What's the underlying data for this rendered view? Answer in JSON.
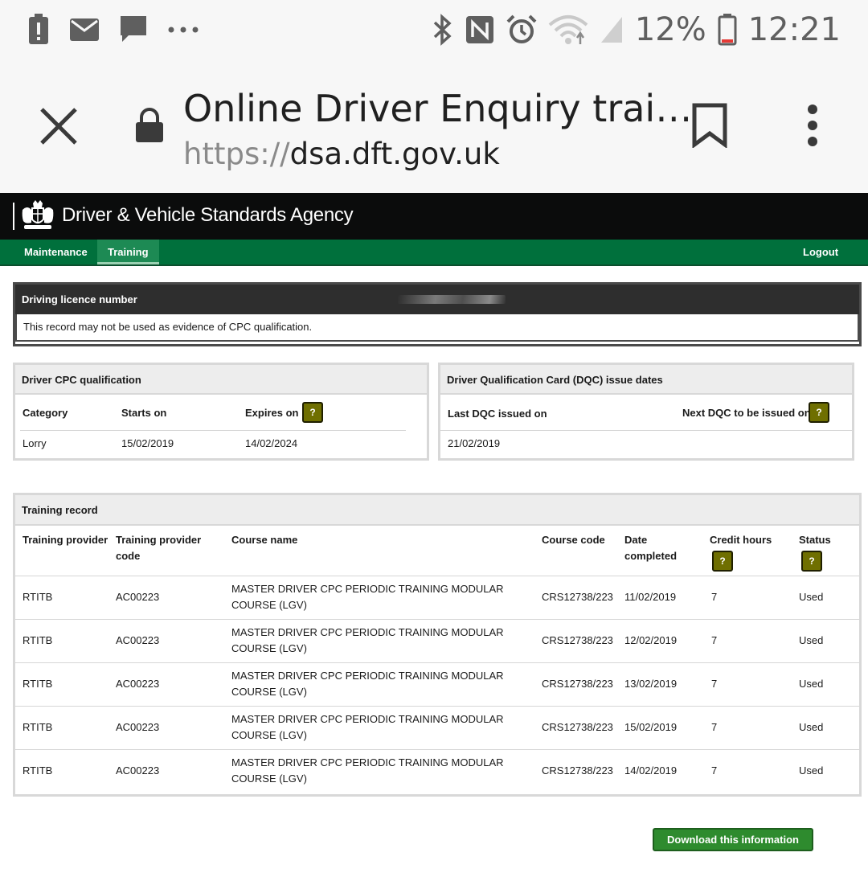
{
  "status_bar": {
    "battery": "12%",
    "time": "12:21",
    "left_icons": [
      "alert-icon",
      "mail-icon",
      "chat-icon",
      "more-dots-icon"
    ],
    "right_icons": [
      "bluetooth-icon",
      "nfc-icon",
      "alarm-icon",
      "wifi-icon",
      "signal-icon",
      "battery-icon"
    ]
  },
  "browser": {
    "title": "Online Driver Enquiry trai…",
    "url_scheme": "https://",
    "url_host": "dsa.dft.gov.uk"
  },
  "agency": {
    "name": "Driver & Vehicle Standards Agency"
  },
  "nav": {
    "items": [
      {
        "label": "Maintenance",
        "active": false
      },
      {
        "label": "Training",
        "active": true
      }
    ],
    "logout": "Logout"
  },
  "licence": {
    "heading": "Driving licence number",
    "notice": "This record may not be used as evidence of CPC qualification."
  },
  "cpc": {
    "heading": "Driver CPC qualification",
    "col_category": "Category",
    "col_starts": "Starts on",
    "col_expires": "Expires on",
    "category": "Lorry",
    "starts": "15/02/2019",
    "expires": "14/02/2024"
  },
  "dqc": {
    "heading": "Driver Qualification Card (DQC) issue dates",
    "col_last": "Last DQC issued on",
    "col_next": "Next DQC to be issued on",
    "last": "21/02/2019",
    "next": ""
  },
  "training": {
    "heading": "Training record",
    "columns": {
      "provider": "Training provider",
      "provider_code": "Training provider code",
      "course_name": "Course name",
      "course_code": "Course code",
      "date_completed": "Date completed",
      "credit_hours": "Credit hours",
      "status": "Status"
    },
    "rows": [
      {
        "provider": "RTITB",
        "provider_code": "AC00223",
        "course_name": "MASTER DRIVER CPC PERIODIC TRAINING MODULAR COURSE (LGV)",
        "course_code": "CRS12738/223",
        "date": "11/02/2019",
        "hours": "7",
        "status": "Used"
      },
      {
        "provider": "RTITB",
        "provider_code": "AC00223",
        "course_name": "MASTER DRIVER CPC PERIODIC TRAINING MODULAR COURSE (LGV)",
        "course_code": "CRS12738/223",
        "date": "12/02/2019",
        "hours": "7",
        "status": "Used"
      },
      {
        "provider": "RTITB",
        "provider_code": "AC00223",
        "course_name": "MASTER DRIVER CPC PERIODIC TRAINING MODULAR COURSE (LGV)",
        "course_code": "CRS12738/223",
        "date": "13/02/2019",
        "hours": "7",
        "status": "Used"
      },
      {
        "provider": "RTITB",
        "provider_code": "AC00223",
        "course_name": "MASTER DRIVER CPC PERIODIC TRAINING MODULAR COURSE (LGV)",
        "course_code": "CRS12738/223",
        "date": "15/02/2019",
        "hours": "7",
        "status": "Used"
      },
      {
        "provider": "RTITB",
        "provider_code": "AC00223",
        "course_name": "MASTER DRIVER CPC PERIODIC TRAINING MODULAR COURSE (LGV)",
        "course_code": "CRS12738/223",
        "date": "14/02/2019",
        "hours": "7",
        "status": "Used"
      }
    ]
  },
  "help_label": "?",
  "download_label": "Download this information",
  "colors": {
    "agency_black": "#0b0c0c",
    "nav_green": "#00703c",
    "help_olive": "#6f6f00",
    "download_green": "#2e8b2e"
  }
}
